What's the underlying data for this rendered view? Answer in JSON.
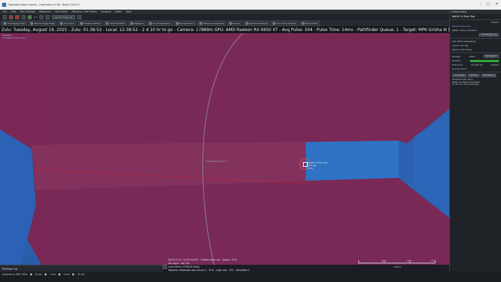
{
  "window": {
    "title": "Operation Polar Liberty - Command v1.06 - Build 1328.11",
    "controls": [
      "–",
      "□",
      "✕"
    ]
  },
  "menu": [
    "File",
    "View",
    "Map Settings",
    "Reference",
    "Unit Orders",
    "Missions + Ref. Points",
    "Contacts",
    "Editor",
    "Help"
  ],
  "toolbar1": {
    "speed_label": "Speed: Follow 2X",
    "counter": "x 1"
  },
  "toolbar2": [
    {
      "name": "auto-engage",
      "label": "Auto Engage Target"
    },
    {
      "name": "manual-engage",
      "label": "Manual Engage Target"
    },
    {
      "name": "plot-course",
      "label": "Plot Course"
    },
    {
      "name": "throttle",
      "label": "Throttle & Altitude"
    },
    {
      "name": "formation",
      "label": "Formation Editor"
    },
    {
      "name": "magazines",
      "label": "Magazines"
    },
    {
      "name": "aircraft-ops",
      "label": "Aircraft Operations"
    },
    {
      "name": "boat-ops",
      "label": "Boat Operations"
    },
    {
      "name": "weapons-readiness",
      "label": "Weapons & Readiness"
    },
    {
      "name": "sensors",
      "label": "Sensors"
    },
    {
      "name": "systems-damage",
      "label": "Systems & Damage"
    },
    {
      "name": "unit-group-doctrine",
      "label": "Unit / Group Doctrine"
    },
    {
      "name": "mission-editor",
      "label": "Mission Editor"
    }
  ],
  "statusline": "Zulu: Tuesday, August 19, 2025 - Zulu: 01:38:52 - Local: 12:38:52 - 2 d 10 hr to go - Camera: 17889m  GPU: AMD Radeon RX 6950 XT - Avg Pulse: 504 - Pulse Time: 14ms - Pathfinder Queue: 1 - Target: MPK Grisha III [Pr.1124M Albat",
  "map": {
    "selected_label": "Selected:",
    "selected_unit": "1x WAGB 10 Polar Star",
    "zone_label": "Icebreaking Zone 1",
    "unit_label": [
      "WAGB 10 Polar Star",
      "272 deg",
      "3 kts"
    ],
    "colors": {
      "hostile_area": "#8a2a4e",
      "water": "#2f73c4",
      "land_edge": "#2a5590"
    }
  },
  "coords": {
    "line1": "N70°21'12\", E170°34'39\" - 2,856m from ref. - Depth: -92ft",
    "line2": "No Layer - No CZs",
    "line3": "Local time: 12:38:52 (Day)",
    "line4": "Weather: Moderate low clouds 2 - 7k ft - Light rain - 8°C - Wind/Sea 2"
  },
  "scale": {
    "labels": [
      "0",
      "1000",
      "2000",
      "3000"
    ],
    "units": "Meters"
  },
  "msglog": {
    "title": "Message Log"
  },
  "bottombar": {
    "mode": "Switched to UNIT VIEW",
    "speeds": [
      "15 sec",
      "1 min",
      "5 min",
      "15 min"
    ]
  },
  "panel": {
    "header": "Contact Status",
    "unit_name": "WAGB 10 Polar Star",
    "unit_side": "Singular",
    "class_link": "WAGB 10 Polar Star",
    "class_type": "WAGB - Heavy Icebreaker",
    "message_log_btn": "Unit Message Log",
    "side": "Side: NATO (Icebreaking)",
    "course": "Course: 272 deg",
    "speed": "Speed: 3 kts (Creep)",
    "damage_label": "Damage:",
    "damage_value": "0.00%",
    "damage_btn": "Damage Ctrl",
    "systems_label": "Systems:",
    "fuel_label": "Fuel and Ammo",
    "endurance_label": "Endurance:",
    "aircraft": "Aircraft: 0/1",
    "supplies": "Supplies",
    "buttons": [
      "Unit Orders",
      "Doctrine",
      "Unit Sensors"
    ],
    "notes": [
      "Assigned Icean: None",
      "Status: On Patrol (Underway)",
      "0 h 00 min: Time Underway"
    ]
  }
}
